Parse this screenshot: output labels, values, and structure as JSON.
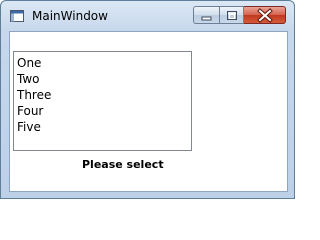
{
  "window": {
    "title": "MainWindow"
  },
  "caption_buttons": {
    "minimize_icon": "minimize-icon",
    "maximize_icon": "maximize-icon",
    "close_icon": "close-icon"
  },
  "listbox": {
    "items": [
      "One",
      "Two",
      "Three",
      "Four",
      "Five"
    ]
  },
  "status": {
    "prompt": "Please select"
  },
  "colors": {
    "titlebar": "#c7d8ec",
    "close_button": "#c7432a",
    "list_border": "#828790"
  }
}
